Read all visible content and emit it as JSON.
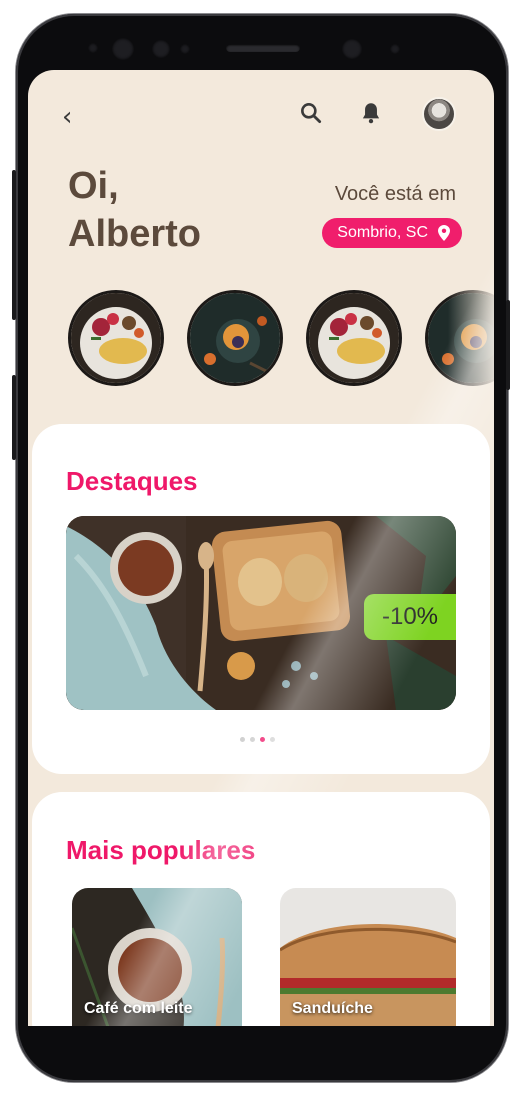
{
  "greeting": {
    "line1": "Oi,",
    "line2": "Alberto"
  },
  "location": {
    "label": "Você está em",
    "city": "Sombrio, SC"
  },
  "icons": {
    "back": "chevron-left-icon",
    "search": "search-icon",
    "notifications": "bell-icon",
    "location": "map-pin-icon"
  },
  "sections": {
    "highlights_title": "Destaques",
    "popular_title": "Mais populares"
  },
  "highlight_banner": {
    "discount": "-10%"
  },
  "carousel": {
    "count": 4,
    "active_index": 2
  },
  "popular": [
    {
      "name": "Café com leite"
    },
    {
      "name": "Sanduíche"
    }
  ],
  "colors": {
    "accent": "#ef1869",
    "background": "#f3e9dc",
    "discount": "#7ed321",
    "heading": "#5c4a3c"
  }
}
